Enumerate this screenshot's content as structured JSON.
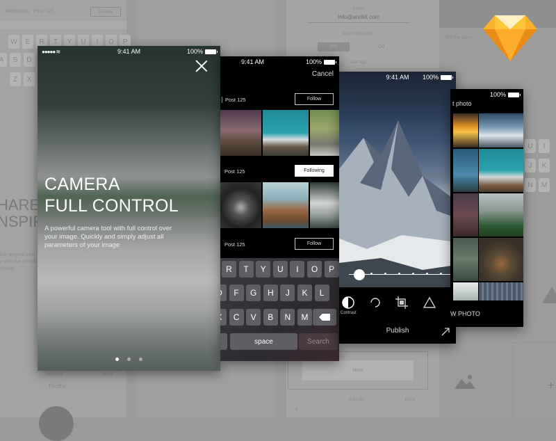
{
  "background_wireframes": {
    "top_left": {
      "username": "Meticulous",
      "post": "Post: 125",
      "follow": "Follow"
    },
    "keyboard_rows": [
      [
        "W",
        "E",
        "R",
        "T",
        "Y",
        "U",
        "I",
        "O",
        "P"
      ],
      [
        "A",
        "S",
        "D"
      ],
      [
        "Z",
        "X"
      ]
    ],
    "left_hero": {
      "line1": "HARE",
      "line2": "NSPIRA",
      "desc_lines": [
        "lish original cont",
        "e with the creativ",
        "munity"
      ]
    },
    "profile_screen": {
      "time": "9:41 AM",
      "battery": "100%",
      "title": "Profile"
    },
    "settings_screen": {
      "email_label": "Email",
      "email_value": "Info@anrikit.com",
      "push_label": "Push notification",
      "on": "ON",
      "off": "Off",
      "start_app": "Start app"
    },
    "next_button": "Next",
    "bottom_status": {
      "time": "9:41 AM",
      "battery": "100%"
    },
    "story_placeholder": "Tell the story ...",
    "right_keyboard": [
      "U",
      "I",
      "J",
      "K",
      "N",
      "M"
    ]
  },
  "status_bar": {
    "time": "9:41 AM",
    "battery": "100%"
  },
  "onboarding": {
    "title_line1": "CAMERA",
    "title_line2": "FULL CONTROL",
    "description": "A powerful camera tool with full control over your image. Quickly and simply adjust all parameters of your image",
    "page_count": 3,
    "active_page": 1
  },
  "search_screen": {
    "cancel": "Cancel",
    "posts": [
      {
        "label": "Post  125",
        "button": "Follow",
        "following": false
      },
      {
        "label": "Post  125",
        "button": "Following",
        "following": true
      },
      {
        "label": "Post  125",
        "button": "Follow",
        "following": false
      }
    ],
    "keyboard": {
      "row1": [
        "R",
        "T",
        "Y",
        "U",
        "I",
        "O",
        "P"
      ],
      "row2": [
        "D",
        "F",
        "G",
        "H",
        "J",
        "K",
        "L"
      ],
      "row3": [
        "X",
        "C",
        "V",
        "B",
        "N",
        "M"
      ],
      "space": "space",
      "search": "Search"
    }
  },
  "editor_screen": {
    "tools": [
      {
        "name": "contrast-icon",
        "label": "Contrast"
      },
      {
        "name": "rotate-icon",
        "label": ""
      },
      {
        "name": "crop-icon",
        "label": ""
      },
      {
        "name": "triangle-icon",
        "label": ""
      }
    ],
    "slider_value": 0.05,
    "publish": "Publish"
  },
  "gallery_screen": {
    "title": "t photo",
    "new_photo": "W PHOTO"
  },
  "colors": {
    "sketch_orange": "#f7a51f",
    "sketch_yellow": "#fdd231"
  }
}
